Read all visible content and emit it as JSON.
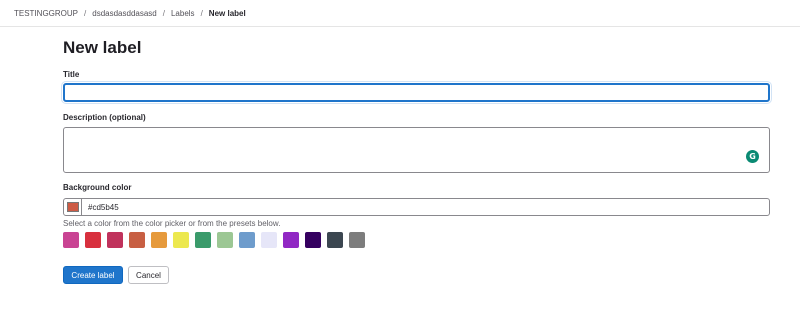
{
  "breadcrumb": {
    "items": [
      "TESTINGGROUP",
      "dsdasdasddasasd",
      "Labels"
    ],
    "current": "New label",
    "separator": "/"
  },
  "page": {
    "title": "New label"
  },
  "form": {
    "title_label": "Title",
    "title_value": "",
    "description_label": "Description (optional)",
    "description_value": "",
    "background_label": "Background color",
    "color_value": "#cd5b45",
    "help_text": "Select a color from the color picker or from the presets below.",
    "presets": [
      "#c94393",
      "#d8303e",
      "#c0325c",
      "#c85f43",
      "#e69a3c",
      "#ece84f",
      "#3a9b6b",
      "#9cc794",
      "#6e9ccc",
      "#e6e6f8",
      "#9128c4",
      "#350060",
      "#3b4650",
      "#7d7d7d"
    ]
  },
  "actions": {
    "create_label": "Create label",
    "cancel_label": "Cancel"
  },
  "icons": {
    "grammarly": "grammarly-icon"
  },
  "colors": {
    "accent": "#1f75cb"
  }
}
